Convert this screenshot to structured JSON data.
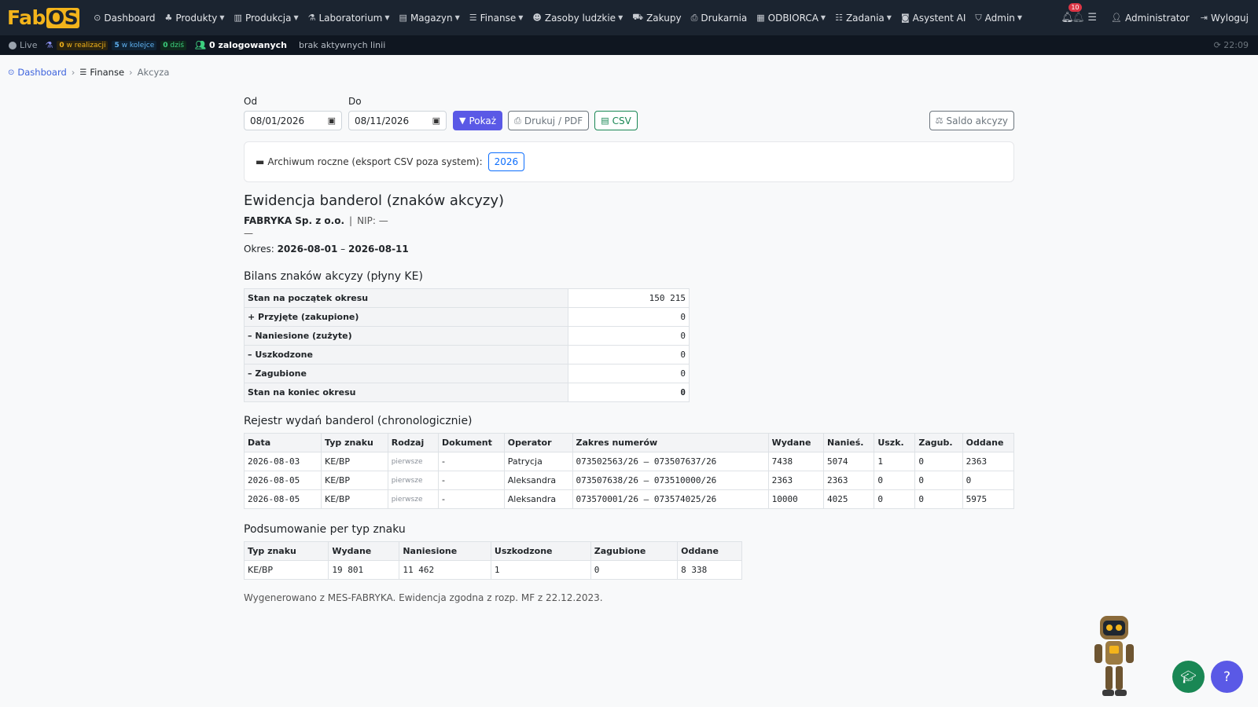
{
  "navbar": {
    "logo_fab": "Fab",
    "logo_os": "OS",
    "items": [
      {
        "label": "Dashboard",
        "icon": "⊙",
        "dropdown": false
      },
      {
        "label": "Produkty",
        "icon": "♣",
        "dropdown": true
      },
      {
        "label": "Produkcja",
        "icon": "▥",
        "dropdown": true
      },
      {
        "label": "Laboratorium",
        "icon": "⚗",
        "dropdown": true
      },
      {
        "label": "Magazyn",
        "icon": "▤",
        "dropdown": true
      },
      {
        "label": "Finanse",
        "icon": "☰",
        "dropdown": true
      },
      {
        "label": "Zasoby ludzkie",
        "icon": "☻",
        "dropdown": true
      },
      {
        "label": "Zakupy",
        "icon": "⛟",
        "dropdown": false
      },
      {
        "label": "Drukarnia",
        "icon": "⎙",
        "dropdown": false
      },
      {
        "label": "ODBIORCA",
        "icon": "▦",
        "dropdown": true
      },
      {
        "label": "Zadania",
        "icon": "☷",
        "dropdown": true
      },
      {
        "label": "Asystent AI",
        "icon": "◙",
        "dropdown": false
      },
      {
        "label": "Admin",
        "icon": "⛉",
        "dropdown": true
      }
    ],
    "notifications_count": "10",
    "user_label": "Administrator",
    "logout_label": "Wyloguj"
  },
  "statusbar": {
    "live_label": "Live",
    "in_progress_count": "0",
    "in_progress_label": "w realizacji",
    "queue_count": "5",
    "queue_label": "w kolejce",
    "today_count": "0",
    "today_label": "dziś",
    "logged_in_label": "0 zalogowanych",
    "lines_label": "brak aktywnych linii",
    "clock": "⟳ 22:09"
  },
  "breadcrumb": {
    "home": "Dashboard",
    "section": "Finanse",
    "current": "Akcyza"
  },
  "filters": {
    "from_label": "Od",
    "from_value": "08/01/2026",
    "to_label": "Do",
    "to_value": "08/11/2026",
    "show_label": "Pokaż",
    "print_label": "Drukuj / PDF",
    "csv_label": "CSV",
    "saldo_label": "Saldo akcyzy"
  },
  "archive": {
    "label": "Archiwum roczne (eksport CSV poza system):",
    "year": "2026"
  },
  "report": {
    "title": "Ewidencja banderol (znaków akcyzy)",
    "company": "FABRYKA Sp. z o.o.",
    "nip": "NIP: —",
    "dash": "—",
    "period_label": "Okres:",
    "period_from": "2026-08-01",
    "period_sep": "–",
    "period_to": "2026-08-11"
  },
  "bilans": {
    "title": "Bilans znaków akcyzy (płyny KE)",
    "rows": [
      {
        "label": "Stan na początek okresu",
        "value": "150 215"
      },
      {
        "label": "+ Przyjęte (zakupione)",
        "value": "0"
      },
      {
        "label": "– Naniesione (zużyte)",
        "value": "0"
      },
      {
        "label": "– Uszkodzone",
        "value": "0"
      },
      {
        "label": "– Zagubione",
        "value": "0"
      },
      {
        "label": "Stan na koniec okresu",
        "value": "0"
      }
    ]
  },
  "register": {
    "title": "Rejestr wydań banderol (chronologicznie)",
    "headers": [
      "Data",
      "Typ znaku",
      "Rodzaj",
      "Dokument",
      "Operator",
      "Zakres numerów",
      "Wydane",
      "Nanieś.",
      "Uszk.",
      "Zagub.",
      "Oddane"
    ],
    "rows": [
      [
        "2026-08-03",
        "KE/BP",
        "pierwsze",
        "-",
        "Patrycja",
        "073502563/26 — 073507637/26",
        "7438",
        "5074",
        "1",
        "0",
        "2363"
      ],
      [
        "2026-08-05",
        "KE/BP",
        "pierwsze",
        "-",
        "Aleksandra",
        "073507638/26 — 073510000/26",
        "2363",
        "2363",
        "0",
        "0",
        "0"
      ],
      [
        "2026-08-05",
        "KE/BP",
        "pierwsze",
        "-",
        "Aleksandra",
        "073570001/26 — 073574025/26",
        "10000",
        "4025",
        "0",
        "0",
        "5975"
      ]
    ]
  },
  "summary": {
    "title": "Podsumowanie per typ znaku",
    "headers": [
      "Typ znaku",
      "Wydane",
      "Naniesione",
      "Uszkodzone",
      "Zagubione",
      "Oddane"
    ],
    "rows": [
      [
        "KE/BP",
        "19 801",
        "11 462",
        "1",
        "0",
        "8 338"
      ]
    ]
  },
  "footnote": "Wygenerowano z MES-FABRYKA. Ewidencja zgodna z rozp. MF z 22.12.2023.",
  "widgets": {
    "help_label": "?",
    "grad_icon": "graduation-cap-icon"
  }
}
